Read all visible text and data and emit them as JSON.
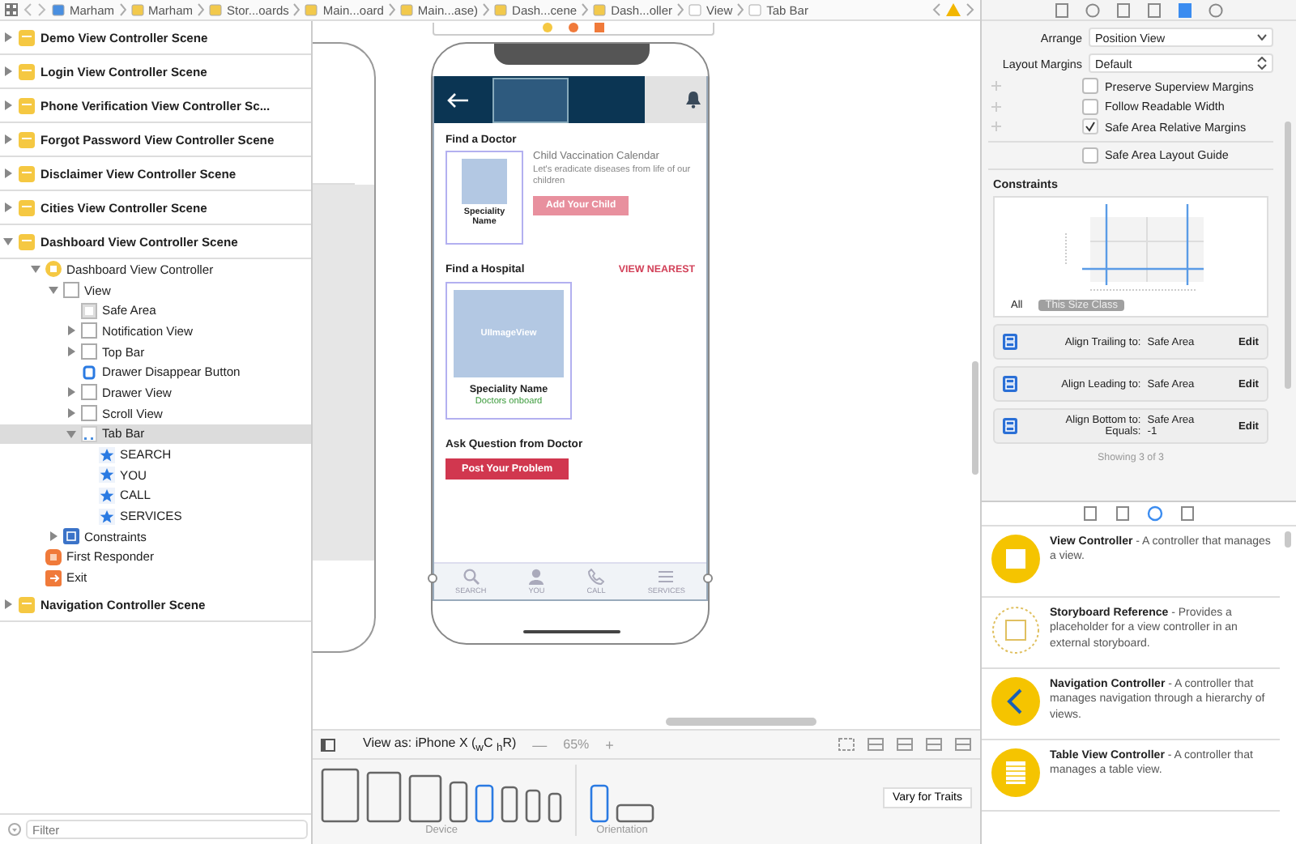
{
  "breadcrumb": [
    "Marham",
    "Marham",
    "Stor...oards",
    "Main...oard",
    "Main...ase)",
    "Dash...cene",
    "Dash...oller",
    "View",
    "Tab Bar"
  ],
  "outline": [
    {
      "label": "Demo View Controller Scene",
      "kind": "scene",
      "expanded": false,
      "selected": false
    },
    {
      "label": "Login View Controller Scene",
      "kind": "scene",
      "expanded": false,
      "selected": false
    },
    {
      "label": "Phone Verification View Controller Sc...",
      "kind": "scene",
      "expanded": false,
      "selected": false
    },
    {
      "label": "Forgot Password View Controller Scene",
      "kind": "scene",
      "expanded": false,
      "selected": false
    },
    {
      "label": "Disclaimer View Controller Scene",
      "kind": "scene",
      "expanded": false,
      "selected": false
    },
    {
      "label": "Cities View Controller Scene",
      "kind": "scene",
      "expanded": false,
      "selected": false
    },
    {
      "label": "Dashboard View Controller Scene",
      "kind": "scene",
      "expanded": true,
      "selected": false,
      "children": [
        {
          "label": "Dashboard View Controller",
          "kind": "controller",
          "expanded": true,
          "selected": false,
          "children": [
            {
              "label": "View",
              "kind": "view",
              "expanded": true,
              "selected": false,
              "children": [
                {
                  "label": "Safe Area",
                  "kind": "safe-area",
                  "selected": false
                },
                {
                  "label": "Notification View",
                  "kind": "view",
                  "expanded": false,
                  "selected": false
                },
                {
                  "label": "Top Bar",
                  "kind": "view",
                  "expanded": false,
                  "selected": false
                },
                {
                  "label": "Drawer Disappear Button",
                  "kind": "button",
                  "selected": false
                },
                {
                  "label": "Drawer View",
                  "kind": "view",
                  "expanded": false,
                  "selected": false
                },
                {
                  "label": "Scroll View",
                  "kind": "view",
                  "expanded": false,
                  "selected": false
                },
                {
                  "label": "Tab Bar",
                  "kind": "tab-bar",
                  "expanded": true,
                  "selected": true,
                  "children": [
                    {
                      "label": "SEARCH",
                      "kind": "tab-item",
                      "selected": false
                    },
                    {
                      "label": "YOU",
                      "kind": "tab-item",
                      "selected": false
                    },
                    {
                      "label": "CALL",
                      "kind": "tab-item",
                      "selected": false
                    },
                    {
                      "label": "SERVICES",
                      "kind": "tab-item",
                      "selected": false
                    }
                  ]
                }
              ]
            },
            {
              "label": "Constraints",
              "kind": "constraints",
              "expanded": false,
              "selected": false
            }
          ]
        },
        {
          "label": "First Responder",
          "kind": "responder",
          "selected": false
        },
        {
          "label": "Exit",
          "kind": "exit",
          "selected": false
        }
      ]
    },
    {
      "label": "Navigation Controller Scene",
      "kind": "scene",
      "expanded": false,
      "selected": false
    }
  ],
  "filter": {
    "placeholder": "Filter"
  },
  "phone": {
    "find_doctor": "Find a Doctor",
    "calendar_title": "Child Vaccination Calendar",
    "calendar_text": "Let's eradicate diseases from life of our children",
    "add_child": "Add Your Child",
    "doctor_card": {
      "name": "Speciality Name"
    },
    "find_hospital": "Find a Hospital",
    "view_nearest": "VIEW NEAREST",
    "hospital_card": {
      "image": "UIImageView",
      "name": "Speciality Name",
      "count": "Doctors onboard"
    },
    "ask_title": "Ask Question from Doctor",
    "post_button": "Post Your Problem",
    "tabs": [
      {
        "label": "SEARCH"
      },
      {
        "label": "YOU"
      },
      {
        "label": "CALL"
      },
      {
        "label": "SERVICES"
      }
    ]
  },
  "view_as": {
    "label": "View as: iPhone X ($_{w}$C $_{h}$R)",
    "zoom_out": "—",
    "zoom": "65%",
    "zoom_in": "+"
  },
  "devices": [
    {
      "selected": false
    },
    {
      "selected": false
    },
    {
      "selected": false
    },
    {
      "selected": false
    },
    {
      "selected": true
    },
    {
      "selected": false
    },
    {
      "selected": false
    },
    {
      "selected": false
    }
  ],
  "device_label": "Device",
  "orientations": [
    {
      "selected": true
    },
    {
      "selected": false
    }
  ],
  "orientation_label": "Orientation",
  "vary_button": "Vary for Traits",
  "inspector_tabs": [
    {
      "selected": false
    },
    {
      "selected": false
    },
    {
      "selected": false
    },
    {
      "selected": false
    },
    {
      "selected": true
    },
    {
      "selected": false
    }
  ],
  "inspector": {
    "arrange_label": "Arrange",
    "arrange_value": "Position View",
    "margins_label": "Layout Margins",
    "margins_value": "Default",
    "checkboxes": [
      {
        "label": "Preserve Superview Margins",
        "checked": false
      },
      {
        "label": "Follow Readable Width",
        "checked": false
      },
      {
        "label": "Safe Area Relative Margins",
        "checked": true
      }
    ],
    "guide": {
      "label": "Safe Area Layout Guide",
      "checked": false
    },
    "constraints_title": "Constraints",
    "filters": [
      {
        "label": "All",
        "selected": false
      },
      {
        "label": "This Size Class",
        "selected": true
      }
    ],
    "constraints": [
      {
        "title": "Align Trailing to:",
        "target": "Safe Area",
        "edit": "Edit"
      },
      {
        "title": "Align Leading to:",
        "target": "Safe Area",
        "edit": "Edit"
      },
      {
        "title": "Align Bottom to:",
        "target": "Safe Area",
        "extra_label": "Equals:",
        "extra_value": "-1",
        "edit": "Edit"
      }
    ],
    "showing": "Showing 3 of 3"
  },
  "library_tabs": [
    {
      "selected": false
    },
    {
      "selected": false
    },
    {
      "selected": true
    },
    {
      "selected": false
    }
  ],
  "library": [
    {
      "kind": "view-controller",
      "text": "**View Controller** - A controller that manages a view."
    },
    {
      "kind": "storyboard-reference",
      "text": "**Storyboard Reference** - Provides a placeholder for a view controller in an external storyboard."
    },
    {
      "kind": "navigation-controller",
      "text": "**Navigation Controller** - A controller that manages navigation through a hierarchy of views."
    },
    {
      "kind": "table-view-controller",
      "text": "**Table View Controller** - A controller that manages a table view."
    }
  ]
}
